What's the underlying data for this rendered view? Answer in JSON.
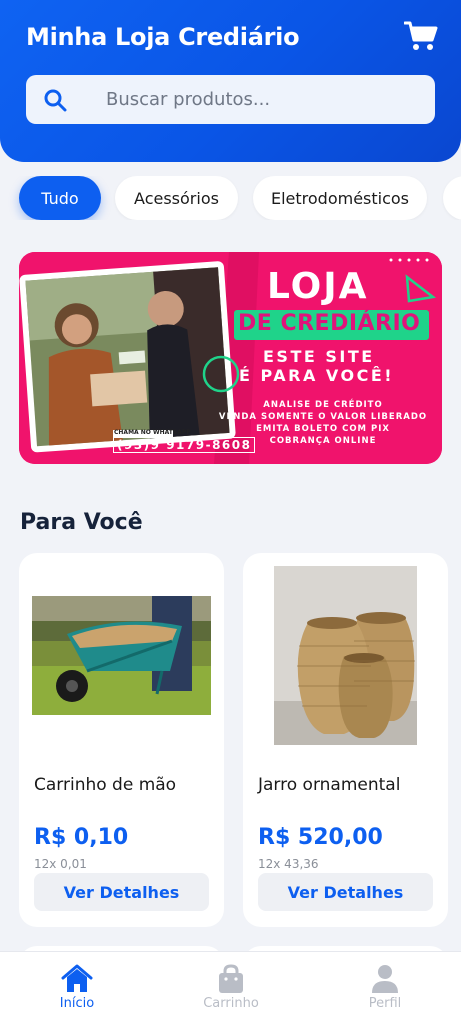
{
  "header": {
    "title": "Minha Loja Crediário",
    "cart_icon": "cart-icon"
  },
  "search": {
    "placeholder": "Buscar produtos...",
    "icon": "search-icon"
  },
  "categories": [
    {
      "label": "Tudo",
      "active": true
    },
    {
      "label": "Acessórios",
      "active": false
    },
    {
      "label": "Eletrodomésticos",
      "active": false
    }
  ],
  "banner": {
    "title_line1": "LOJA",
    "title_line2": "DE CREDIÁRIO",
    "subtitle_line1": "ESTE SITE",
    "subtitle_line2": "É PARA VOCÊ!",
    "info_lines": [
      "ANALISE DE CRÉDITO",
      "VENDA SOMENTE O VALOR LIBERADO",
      "EMITA BOLETO COM PIX",
      "COBRANÇA ONLINE"
    ],
    "whatsapp_label": "CHAMA NO WHATSAPP",
    "phone": "(93)9 9179-8608",
    "colors": {
      "background": "#f0136c",
      "accent_green": "#1fd38a",
      "text": "#ffffff"
    }
  },
  "section": {
    "title": "Para Você"
  },
  "products": [
    {
      "name": "Carrinho de mão",
      "price": "R$ 0,10",
      "installments": "12x 0,01",
      "button": "Ver Detalhes",
      "image": "wheelbarrow-image"
    },
    {
      "name": "Jarro ornamental",
      "price": "R$ 520,00",
      "installments": "12x 43,36",
      "button": "Ver Detalhes",
      "image": "wicker-vases-image"
    }
  ],
  "nav": [
    {
      "label": "Início",
      "icon": "home-icon",
      "active": true
    },
    {
      "label": "Carrinho",
      "icon": "bag-icon",
      "active": false
    },
    {
      "label": "Perfil",
      "icon": "user-icon",
      "active": false
    }
  ],
  "theme": {
    "primary": "#0d5ff0",
    "background": "#f1f3f8"
  }
}
